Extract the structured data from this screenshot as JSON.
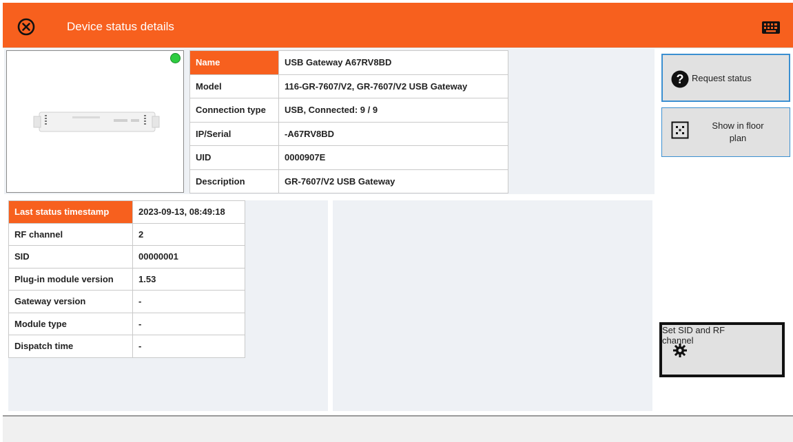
{
  "header": {
    "title": "Device status details",
    "accent_color": "#f7601e",
    "close_icon": "close-circle-icon",
    "keyboard_icon": "keyboard-icon"
  },
  "device": {
    "status_color": "#2ecc40",
    "rows": [
      {
        "label": "Name",
        "value": "USB Gateway A67RV8BD"
      },
      {
        "label": "Model",
        "value": "116-GR-7607/V2, GR-7607/V2 USB Gateway"
      },
      {
        "label": "Connection type",
        "value": "USB, Connected: 9 / 9"
      },
      {
        "label": "IP/Serial",
        "value": "-A67RV8BD"
      },
      {
        "label": "UID",
        "value": "0000907E"
      },
      {
        "label": "Description",
        "value": "GR-7607/V2 USB Gateway"
      }
    ]
  },
  "status": {
    "rows": [
      {
        "label": "Last status timestamp",
        "value": "2023-09-13, 08:49:18"
      },
      {
        "label": "RF channel",
        "value": "2"
      },
      {
        "label": "SID",
        "value": "00000001"
      },
      {
        "label": "Plug-in module version",
        "value": "1.53"
      },
      {
        "label": "Gateway version",
        "value": "-"
      },
      {
        "label": "Module type",
        "value": "-"
      },
      {
        "label": "Dispatch time",
        "value": "-"
      }
    ]
  },
  "actions": {
    "request_status": "Request status",
    "show_floor_plan_line1": "Show in floor",
    "show_floor_plan_line2": "plan",
    "set_sid_line1": "Set SID and RF",
    "set_sid_line2": "channel"
  }
}
